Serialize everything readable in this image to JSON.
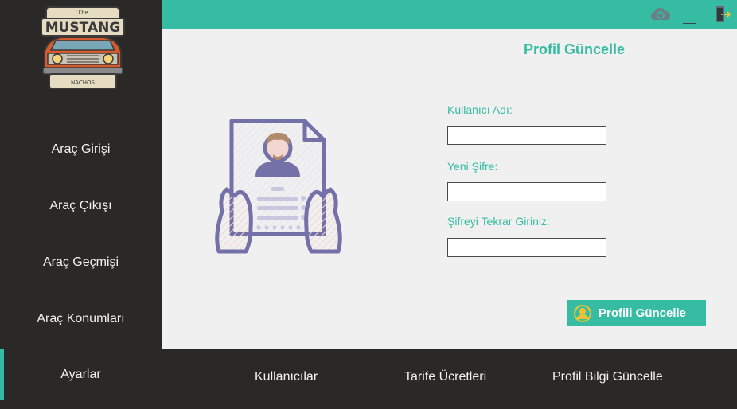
{
  "app": {
    "logo": {
      "top_text": "The",
      "title": "MUSTANG",
      "subtitle": "NACHOS"
    }
  },
  "sidebar": {
    "items": [
      {
        "label": "Araç Girişi"
      },
      {
        "label": "Araç Çıkışı"
      },
      {
        "label": "Araç Geçmişi"
      },
      {
        "label": "Araç Konumları"
      },
      {
        "label": "Ayarlar",
        "active": true
      }
    ]
  },
  "topbar": {
    "icons": [
      "cloud-power-icon",
      "minimize-icon",
      "exit-door-icon"
    ],
    "minimize_label": "__"
  },
  "form": {
    "title": "Profil Güncelle",
    "fields": [
      {
        "label": "Kullanıcı Adı:",
        "value": ""
      },
      {
        "label": "Yeni Şifre:",
        "value": ""
      },
      {
        "label": "Şifreyi Tekrar Giriniz:",
        "value": ""
      }
    ],
    "submit_label": "Profili Güncelle"
  },
  "bottom_tabs": [
    {
      "label": "Kullanıcılar"
    },
    {
      "label": "Tarife Ücretleri"
    },
    {
      "label": "Profil Bilgi Güncelle"
    }
  ],
  "colors": {
    "accent": "#35bca3",
    "dark": "#2b2928",
    "content_bg": "#f0f0f0"
  }
}
